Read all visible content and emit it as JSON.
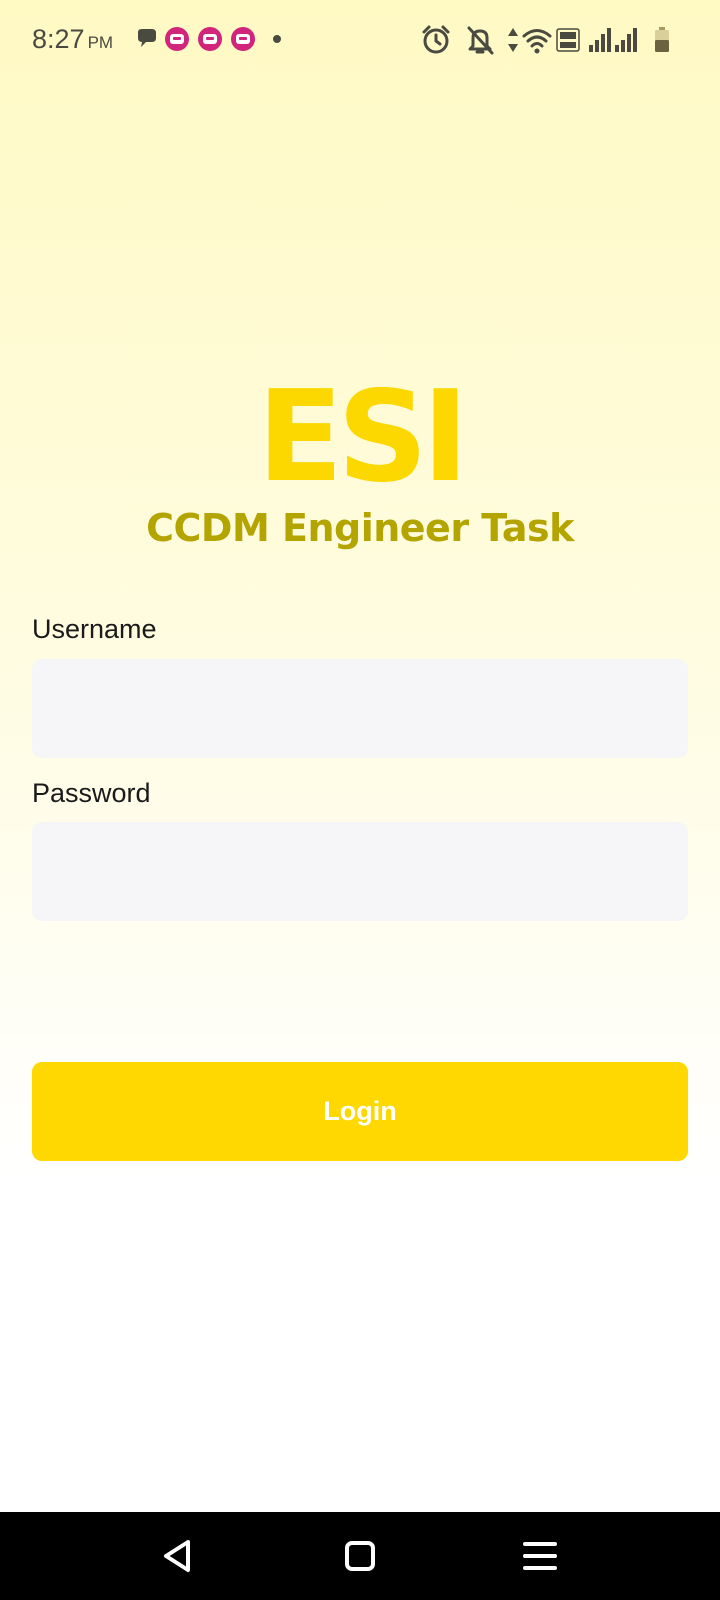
{
  "status_bar": {
    "time": "8:27",
    "ampm": "PM",
    "icons": [
      "chat-bubble-icon",
      "app-notification-icon",
      "app-notification-icon",
      "app-notification-icon",
      "more-dot-icon",
      "alarm-icon",
      "bell-off-icon",
      "data-arrows-icon",
      "wifi-icon",
      "volte-icon",
      "signal-icon",
      "signal-icon",
      "battery-icon"
    ],
    "notification_color": "#d0257a"
  },
  "logo": {
    "title": "ESI",
    "subtitle": "CCDM Engineer Task",
    "title_color": "#fcd800",
    "subtitle_color": "#b3a400"
  },
  "form": {
    "username_label": "Username",
    "username_value": "",
    "password_label": "Password",
    "password_value": ""
  },
  "login": {
    "label": "Login",
    "color": "#fed800"
  },
  "nav_bar": {
    "icons": [
      "back-icon",
      "home-icon",
      "menu-icon"
    ]
  }
}
